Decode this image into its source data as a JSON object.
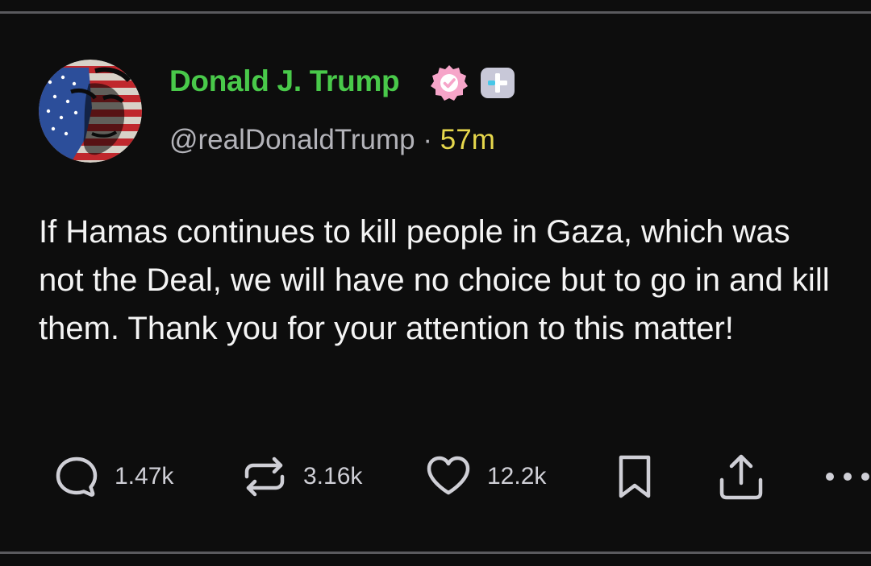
{
  "post": {
    "author": {
      "display_name": "Donald J. Trump",
      "handle": "@realDonaldTrump",
      "avatar_icon": "avatar-flag-portrait-icon",
      "verified_badge_icon": "verified-badge-icon",
      "verified_badge_color": "#f6a5c9",
      "plus_badge_icon": "plus-badge-icon",
      "name_color": "#49c94a"
    },
    "separator": "·",
    "timestamp": "57m",
    "timestamp_color": "#e6d74c",
    "text": "If Hamas continues to kill people in Gaza, which was not the Deal, we will have no choice but to go in and kill them. Thank you for your attention to this matter!"
  },
  "actions": {
    "reply": {
      "icon": "reply-bubble-icon",
      "count": "1.47k"
    },
    "repost": {
      "icon": "repost-icon",
      "count": "3.16k"
    },
    "like": {
      "icon": "heart-icon",
      "count": "12.2k"
    },
    "bookmark": {
      "icon": "bookmark-icon"
    },
    "share": {
      "icon": "share-icon"
    },
    "more": {
      "icon": "more-horizontal-icon"
    }
  }
}
